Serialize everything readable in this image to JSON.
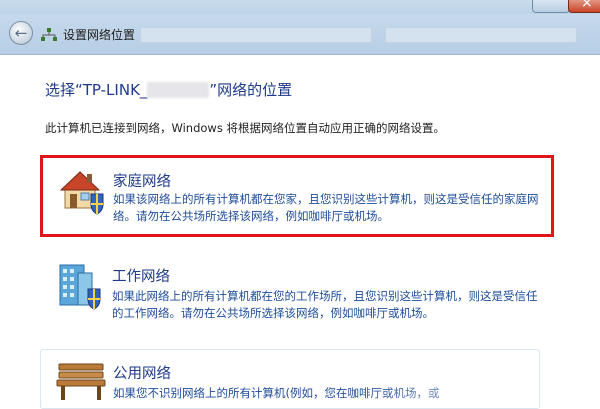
{
  "window": {
    "nav_title": "设置网络位置"
  },
  "main": {
    "heading_prefix": "选择“TP-LINK_",
    "heading_suffix": "”网络的位置",
    "description": "此计算机已连接到网络，Windows 将根据网络位置自动应用正确的网络设置。"
  },
  "options": [
    {
      "title": "家庭网络",
      "body": "如果该网络上的所有计算机都在您家，且您识别这些计算机，则这是受信任的家庭网络。请勿在公共场所选择该网络，例如咖啡厅或机场。",
      "icon": "home-network-icon",
      "highlighted": true
    },
    {
      "title": "工作网络",
      "body": "如果此网络上的所有计算机都在您的工作场所，且您识别这些计算机，则这是受信任的工作网络。请勿在公共场所选择该网络，例如咖啡厅或机场。",
      "icon": "work-network-icon"
    },
    {
      "title": "公用网络",
      "body": "如果您不识别网络上的所有计算机(例如，您在咖啡厅或机场，或",
      "icon": "public-network-icon"
    }
  ],
  "colors": {
    "highlight_border": "#e0151b",
    "link_blue": "#1e3a8a"
  }
}
